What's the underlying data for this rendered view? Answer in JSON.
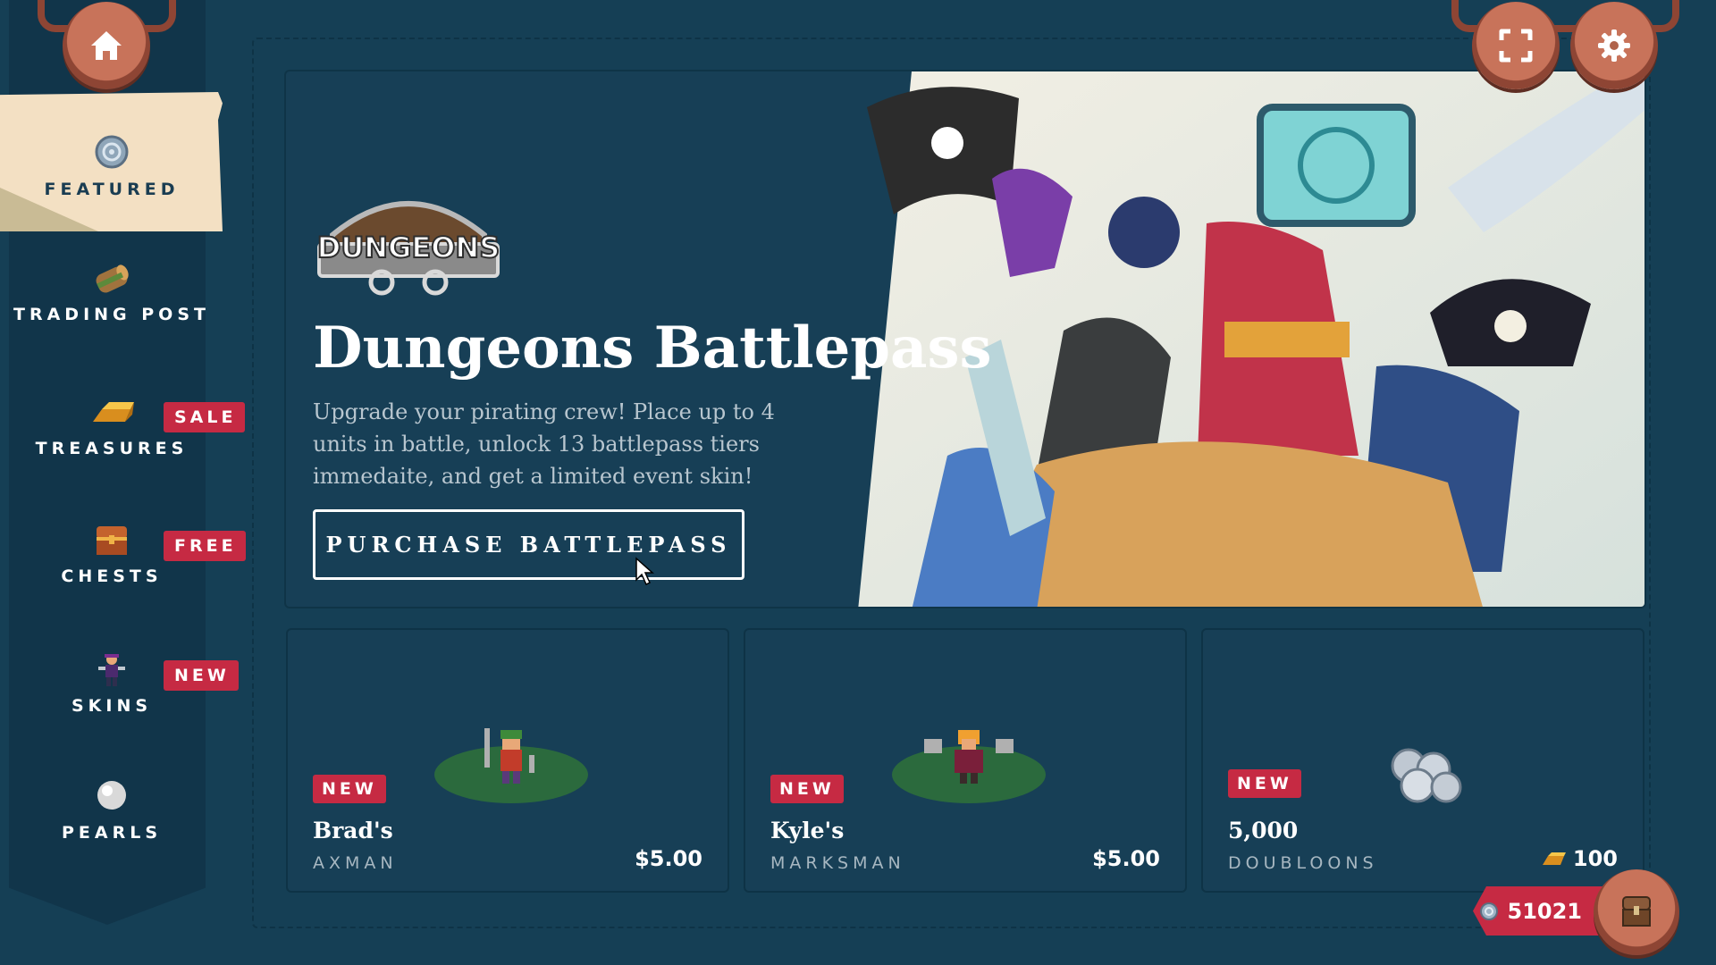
{
  "sidebar": {
    "items": [
      {
        "label": "FEATURED",
        "icon": "coin-icon",
        "active": true
      },
      {
        "label": "TRADING POST",
        "icon": "log-icon"
      },
      {
        "label": "TREASURES",
        "icon": "gold-bar-icon",
        "tag": "SALE"
      },
      {
        "label": "CHESTS",
        "icon": "chest-icon",
        "tag": "FREE"
      },
      {
        "label": "SKINS",
        "icon": "character-icon",
        "tag": "NEW"
      },
      {
        "label": "PEARLS",
        "icon": "pearl-icon"
      }
    ]
  },
  "hero": {
    "logo_text": "DUNGEONS",
    "title": "Dungeons Battlepass",
    "description": "Upgrade your pirating crew! Place up to 4 units in battle, unlock 13 battlepass tiers immedaite, and get a limited event skin!",
    "button_label": "PURCHASE BATTLEPASS"
  },
  "cards": [
    {
      "tag": "NEW",
      "name": "Brad's",
      "subtitle": "AXMAN",
      "price": "$5.00"
    },
    {
      "tag": "NEW",
      "name": "Kyle's",
      "subtitle": "MARKSMAN",
      "price": "$5.00"
    },
    {
      "tag": "NEW",
      "name": "5,000",
      "subtitle": "DOUBLOONS",
      "price": "100"
    }
  ],
  "currency": {
    "amount": "51021"
  },
  "colors": {
    "background": "#153f55",
    "sidebar": "#11354a",
    "accent_red": "#c62a43",
    "copper": "#c8735a",
    "parchment": "#f3e0c3"
  }
}
